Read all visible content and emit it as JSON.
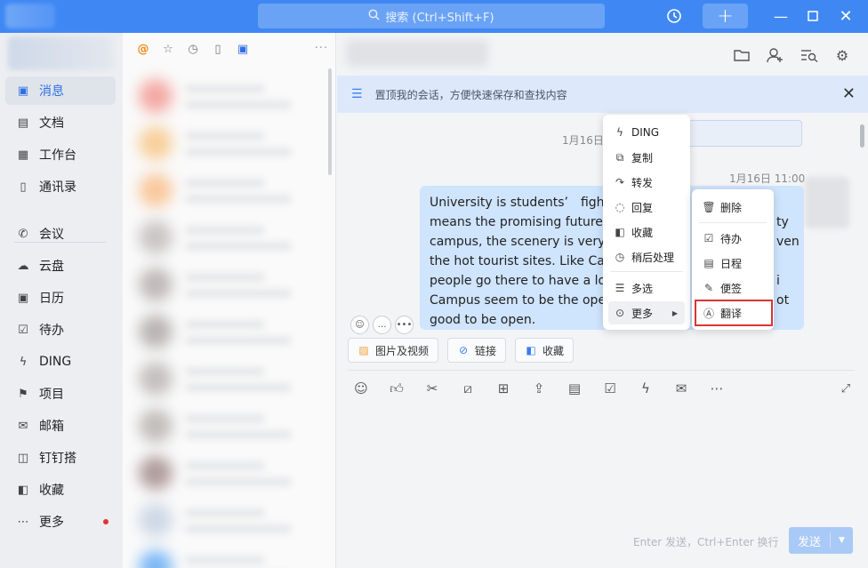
{
  "titlebar": {
    "search_placeholder": "搜索 (Ctrl+Shift+F)",
    "history_icon": "history-icon",
    "add_icon": "plus-icon",
    "accent_color": "#3f88f3"
  },
  "sidebar": {
    "items": [
      {
        "label": "消息",
        "icon": "message-icon",
        "glyph": "▣",
        "active": true
      },
      {
        "label": "文档",
        "icon": "document-icon",
        "glyph": "▤"
      },
      {
        "label": "工作台",
        "icon": "workbench-icon",
        "glyph": "▦"
      },
      {
        "label": "通讯录",
        "icon": "contacts-icon",
        "glyph": "▯"
      },
      {
        "label": "会议",
        "icon": "meeting-icon",
        "glyph": "✆"
      },
      {
        "label": "云盘",
        "icon": "cloud-icon",
        "glyph": "☁"
      },
      {
        "label": "日历",
        "icon": "calendar-icon",
        "glyph": "▣"
      },
      {
        "label": "待办",
        "icon": "todo-icon",
        "glyph": "☑"
      },
      {
        "label": "DING",
        "icon": "ding-icon",
        "glyph": "ϟ"
      },
      {
        "label": "项目",
        "icon": "project-icon",
        "glyph": "⚑"
      },
      {
        "label": "邮箱",
        "icon": "mail-icon",
        "glyph": "✉"
      },
      {
        "label": "钉钉搭",
        "icon": "builder-icon",
        "glyph": "◫"
      },
      {
        "label": "收藏",
        "icon": "favorite-icon",
        "glyph": "◧"
      },
      {
        "label": "更多",
        "icon": "more-icon",
        "glyph": "⋯",
        "dot": true
      }
    ]
  },
  "convlist": {
    "more": "···"
  },
  "chat": {
    "pin_banner": "置顶我的会话，方便快速保存和查找内容",
    "date_label": "1月16日",
    "time_label": "1月16日 11:00",
    "message_lines": [
      "University is students’　fight",
      "means the promising future f",
      "campus, the scenery is very b",
      "the hot tourist sites. Like Cam",
      "people go there to have a loo",
      "Campus seem to be the oper",
      "good to be open."
    ],
    "message_tails": [
      "",
      "ty",
      "ven",
      "",
      "i",
      "ot",
      ""
    ],
    "quick_buttons": [
      {
        "label": "图片及视频",
        "icon": "image-icon"
      },
      {
        "label": "链接",
        "icon": "link-icon"
      },
      {
        "label": "收藏",
        "icon": "favorite-icon"
      }
    ],
    "send_hint": "Enter 发送，Ctrl+Enter 换行",
    "send_label": "发送"
  },
  "context_menu": {
    "items": [
      {
        "label": "DING",
        "icon": "ding-icon",
        "glyph": "ϟ"
      },
      {
        "label": "复制",
        "icon": "copy-icon",
        "glyph": "⧉"
      },
      {
        "label": "转发",
        "icon": "forward-icon",
        "glyph": "↷"
      },
      {
        "label": "回复",
        "icon": "reply-icon",
        "glyph": "◌"
      },
      {
        "label": "收藏",
        "icon": "favorite-icon",
        "glyph": "◧"
      },
      {
        "label": "稍后处理",
        "icon": "clock-icon",
        "glyph": "◷"
      },
      {
        "label": "多选",
        "icon": "multiselect-icon",
        "glyph": "☰"
      },
      {
        "label": "更多",
        "icon": "more-icon",
        "glyph": "⊙"
      }
    ]
  },
  "sub_menu": {
    "items": [
      {
        "label": "删除",
        "icon": "trash-icon",
        "glyph": "🗑"
      },
      {
        "label": "待办",
        "icon": "todo-icon",
        "glyph": "☑"
      },
      {
        "label": "日程",
        "icon": "calendar-icon",
        "glyph": "▤"
      },
      {
        "label": "便签",
        "icon": "note-icon",
        "glyph": "✎"
      },
      {
        "label": "翻译",
        "icon": "translate-icon",
        "glyph": "Ⓐ"
      }
    ]
  }
}
